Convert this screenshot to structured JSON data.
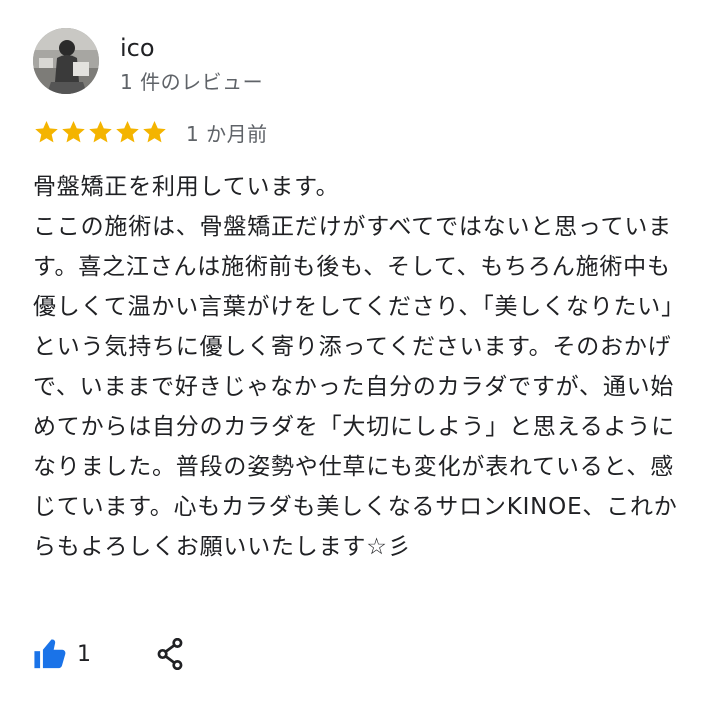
{
  "reviewer": {
    "name": "ico",
    "review_count": "1 件のレビュー",
    "avatar_icon": "profile-photo"
  },
  "rating": {
    "stars": 5,
    "max_stars": 5,
    "star_color": "#f4b400",
    "date": "1 か月前"
  },
  "review": {
    "text": "骨盤矯正を利用しています。\nここの施術は、骨盤矯正だけがすべてではないと思っています。喜之江さんは施術前も後も、そして、もちろん施術中も優しくて温かい言葉がけをしてくださり、「美しくなりたい」という気持ちに優しく寄り添ってくださいます。そのおかげで、いままで好きじゃなかった自分のカラダですが、通い始めてからは自分のカラダを「大切にしよう」と思えるようになりました。普段の姿勢や仕草にも変化が表れていると、感じています。心もカラダも美しくなるサロンKINOE、これからもよろしくお願いいたします☆彡"
  },
  "actions": {
    "like_icon": "thumbs-up-icon",
    "like_color": "#1a73e8",
    "like_count": "1",
    "share_icon": "share-icon"
  }
}
